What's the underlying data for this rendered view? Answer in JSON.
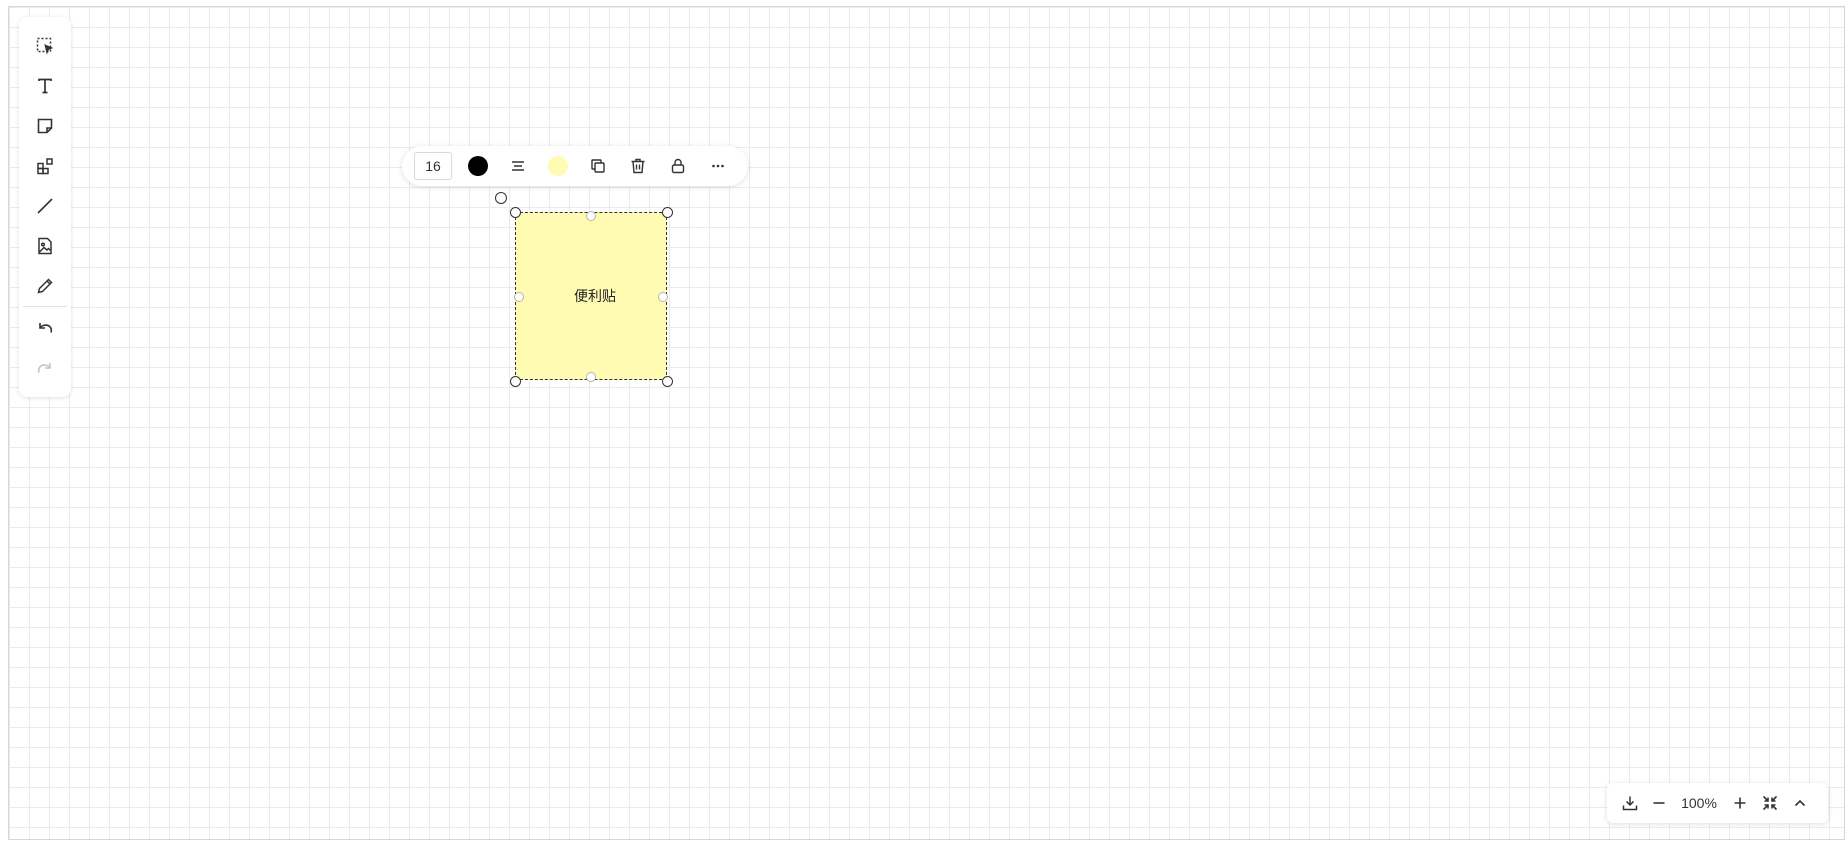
{
  "left_toolbar": {
    "tools": [
      {
        "icon": "select-icon"
      },
      {
        "icon": "text-icon"
      },
      {
        "icon": "sticky-note-icon"
      },
      {
        "icon": "shapes-icon"
      },
      {
        "icon": "line-icon"
      },
      {
        "icon": "image-icon"
      },
      {
        "icon": "pen-icon"
      },
      {
        "icon": "undo-icon"
      },
      {
        "icon": "redo-icon",
        "disabled": true
      }
    ]
  },
  "element_toolbar": {
    "font_size": "16",
    "text_color": "#000000",
    "align_icon": "align-center-icon",
    "fill_color": "#fffbb2",
    "actions": [
      "copy-icon",
      "delete-icon",
      "lock-icon",
      "more-icon"
    ]
  },
  "sticky_note": {
    "text": "便利贴",
    "fill_color": "#fffbb2"
  },
  "zoom_controls": {
    "zoom_level": "100%",
    "actions": [
      "download-icon",
      "zoom-out-icon",
      "zoom-in-icon",
      "fit-screen-icon",
      "collapse-icon"
    ]
  },
  "colors": {
    "grid_line": "#ebebeb",
    "accent_text": "#333333"
  }
}
